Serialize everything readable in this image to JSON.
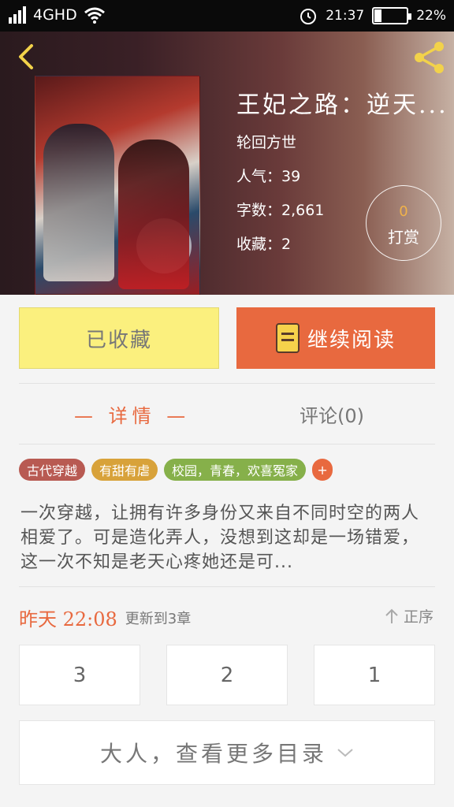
{
  "status_bar": {
    "network": "4GHD",
    "time": "21:37",
    "battery": "22%"
  },
  "book": {
    "title": "王妃之路：逆天...",
    "author": "轮回方世",
    "popularity": "人气：39",
    "word_count": "字数：2,661",
    "favorites": "收藏：2"
  },
  "reward": {
    "count": "0",
    "label": "打赏"
  },
  "actions": {
    "favorite_label": "已收藏",
    "read_label": "继续阅读"
  },
  "tabs": {
    "details": "— 详情 —",
    "comments": "评论(0)"
  },
  "tags": [
    "古代穿越",
    "有甜有虐",
    "校园，青春，欢喜冤家"
  ],
  "tag_add": "+",
  "description": "一次穿越，让拥有许多身份又来自不同时空的两人相爱了。可是造化弄人，没想到这却是一场错爱，这一次不知是老天心疼她还是可...",
  "update": {
    "when": "昨天 22:08",
    "text": "更新到3章"
  },
  "order_label": "正序",
  "chapters": [
    "3",
    "2",
    "1"
  ],
  "more_catalog": "大人，查看更多目录",
  "colors": {
    "accent": "#e8693f",
    "favorite_button": "#fbf07e"
  }
}
